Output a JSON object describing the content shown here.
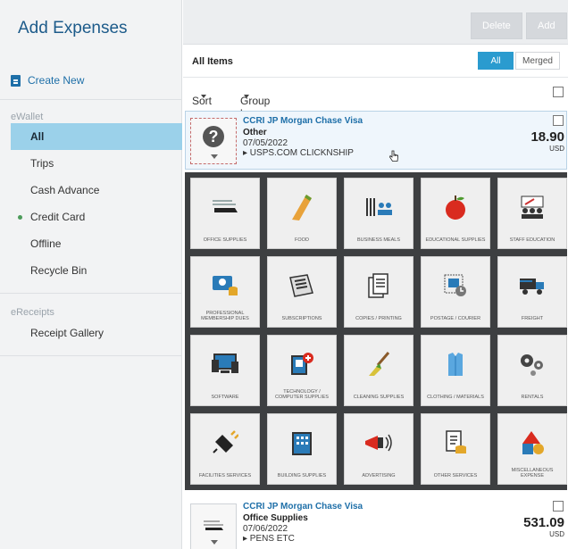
{
  "sidebar": {
    "title": "Add Expenses",
    "create_new": "Create New",
    "ewallet_label": "eWallet",
    "items": [
      {
        "label": "All",
        "active": true
      },
      {
        "label": "Trips"
      },
      {
        "label": "Cash Advance"
      },
      {
        "label": "Credit Card",
        "dot": true
      },
      {
        "label": "Offline"
      },
      {
        "label": "Recycle Bin"
      }
    ],
    "ereceipts_label": "eReceipts",
    "receipt_gallery": "Receipt Gallery"
  },
  "toolbar": {
    "delete_label": "Delete",
    "add_label": "Add"
  },
  "list_header": {
    "title": "All Items",
    "all_toggle": "All",
    "merged_toggle": "Merged"
  },
  "sortbar": {
    "sort_label": "Sort",
    "group_by_label": "Group by: None"
  },
  "expenses": [
    {
      "card_name": "CCRI JP Morgan Chase Visa",
      "category": "Other",
      "date": "07/05/2022",
      "vendor": "▸ USPS.COM CLICKNSHIP",
      "amount": "18.90",
      "currency": "USD"
    },
    {
      "card_name": "CCRI JP Morgan Chase Visa",
      "category": "Office Supplies",
      "date": "07/06/2022",
      "vendor": "▸ PENS ETC",
      "amount": "531.09",
      "currency": "USD"
    }
  ],
  "categories": [
    {
      "label": "OFFICE SUPPLIES",
      "icon": "stapler-icon"
    },
    {
      "label": "FOOD",
      "icon": "sandwich-icon"
    },
    {
      "label": "BUSINESS MEALS",
      "icon": "meal-icon"
    },
    {
      "label": "EDUCATIONAL SUPPLIES",
      "icon": "apple-icon"
    },
    {
      "label": "STAFF EDUCATION",
      "icon": "classroom-icon"
    },
    {
      "label": "PROFESSIONAL MEMBERSHIP DUES",
      "icon": "membership-card-icon"
    },
    {
      "label": "SUBSCRIPTIONS",
      "icon": "newspaper-icon"
    },
    {
      "label": "COPIES / PRINTING",
      "icon": "copies-icon"
    },
    {
      "label": "POSTAGE / COURIER",
      "icon": "postage-icon"
    },
    {
      "label": "FREIGHT",
      "icon": "truck-icon"
    },
    {
      "label": "SOFTWARE",
      "icon": "devices-icon"
    },
    {
      "label": "TECHNOLOGY / COMPUTER SUPPLIES",
      "icon": "tech-supplies-icon"
    },
    {
      "label": "CLEANING SUPPLIES",
      "icon": "broom-icon"
    },
    {
      "label": "CLOTHING / MATERIALS",
      "icon": "shirt-icon"
    },
    {
      "label": "RENTALS",
      "icon": "gears-icon"
    },
    {
      "label": "FACILITIES SERVICES",
      "icon": "plug-icon"
    },
    {
      "label": "BUILDING SUPPLIES",
      "icon": "building-icon"
    },
    {
      "label": "ADVERTISING",
      "icon": "megaphone-icon"
    },
    {
      "label": "OTHER SERVICES",
      "icon": "receipt-coins-icon"
    },
    {
      "label": "MISCELLANEOUS EXPENSE",
      "icon": "shapes-icon"
    }
  ]
}
